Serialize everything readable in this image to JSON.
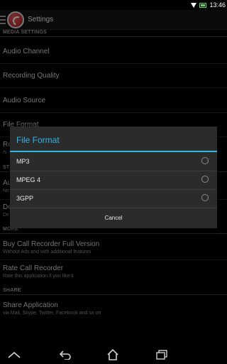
{
  "status_bar": {
    "time": "13:46",
    "icons": [
      "signal-icon",
      "wifi-icon",
      "battery-icon"
    ]
  },
  "action_bar": {
    "title": "Settings"
  },
  "settings": {
    "media_category": "MEDIA SETTINGS",
    "items": [
      {
        "title": "Audio Channel",
        "subtitle": ""
      },
      {
        "title": "Recording Quality",
        "subtitle": ""
      },
      {
        "title": "Audio Source",
        "subtitle": ""
      },
      {
        "title": "File Format",
        "subtitle": ""
      },
      {
        "title": "Re",
        "subtitle": "/s"
      }
    ],
    "partial_category": "ST",
    "partial_items": [
      {
        "title": "Au",
        "subtitle": "Ne"
      },
      {
        "title": "De",
        "subtitle": "De"
      }
    ],
    "more_category": "MORE",
    "more_items": [
      {
        "title": "Buy Call Recorder Full Version",
        "subtitle": "Without Ads and with additional features"
      },
      {
        "title": "Rate Call Recorder",
        "subtitle": "Rate this application if you like it"
      }
    ],
    "share_category": "SHARE",
    "share_items": [
      {
        "title": "Share Application",
        "subtitle": "via Mail, Skype, Twitter, Facebook and so on"
      }
    ]
  },
  "dialog": {
    "title": "File Format",
    "options": [
      {
        "label": "MP3",
        "selected": false
      },
      {
        "label": "MPEG 4",
        "selected": false
      },
      {
        "label": "3GPP",
        "selected": false
      }
    ],
    "cancel_label": "Cancel"
  },
  "colors": {
    "accent": "#33b5e5",
    "dialog_bg": "#2b2b2b",
    "background": "#000000"
  }
}
